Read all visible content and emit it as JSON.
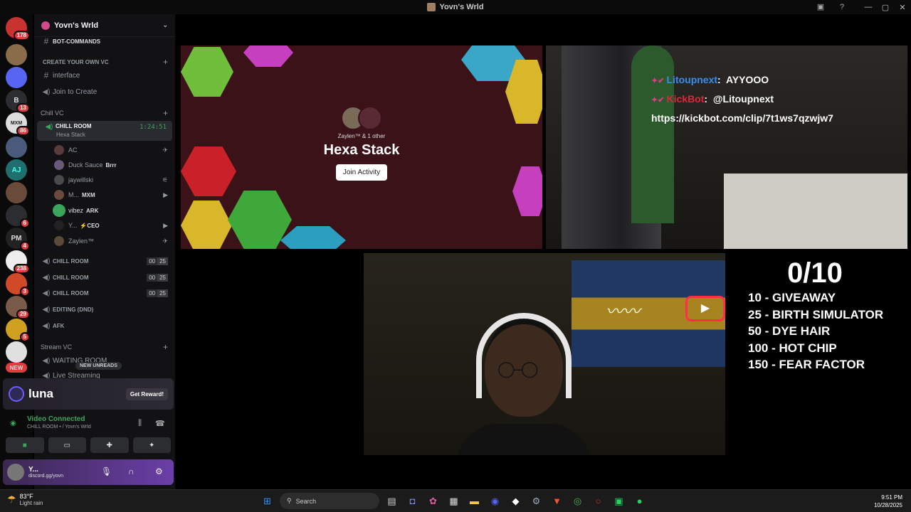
{
  "window": {
    "title": "Yovn's Wrld"
  },
  "rail": {
    "servers": [
      {
        "label": "",
        "badge": "178",
        "color": "#c8322f"
      },
      {
        "label": "",
        "badge": "",
        "color": "#8a6b4a"
      },
      {
        "label": "",
        "badge": "",
        "color": "#5865f2"
      },
      {
        "label": "B",
        "badge": "13",
        "color": "#444"
      },
      {
        "label": "MXM",
        "badge": "86",
        "color": "#ddd"
      },
      {
        "label": "",
        "badge": "",
        "color": "#4a5a7a"
      },
      {
        "label": "AJ",
        "badge": "",
        "color": "#3aa"
      },
      {
        "label": "",
        "badge": "",
        "color": "#6a4a3a"
      },
      {
        "label": "",
        "badge": "6",
        "color": "#555"
      },
      {
        "label": "PM",
        "badge": "4",
        "color": "#222"
      },
      {
        "label": "",
        "badge": "238",
        "color": "#eee"
      },
      {
        "label": "",
        "badge": "3",
        "color": "#d04a2a"
      },
      {
        "label": "",
        "badge": "29",
        "color": "#7a5a4a"
      },
      {
        "label": "",
        "badge": "5",
        "color": "#d0a020"
      },
      {
        "label": "",
        "badge": "",
        "color": "#e0e0e0"
      }
    ],
    "new_label": "NEW"
  },
  "sidebar": {
    "guild_name": "Yovn's Wrld",
    "bot_channel": "BOT-COMMANDS",
    "cat_create": "CREATE YOUR OWN VC",
    "ch_interface": "interface",
    "ch_join": "Join to Create",
    "cat_chill": "Chill VC",
    "active": {
      "name": "CHILL ROOM",
      "activity": "Hexa Stack",
      "timer": "1:24:51"
    },
    "members": [
      {
        "name": "AC",
        "tag": "",
        "icon": "✈"
      },
      {
        "name": "Duck Sauce",
        "tag": "Brrr",
        "icon": ""
      },
      {
        "name": "jaywillski",
        "tag": "",
        "icon": "⚟"
      },
      {
        "name": "M...",
        "tag": "MXM",
        "icon": "▶"
      },
      {
        "name": "vibez",
        "tag": "ARK",
        "icon": ""
      },
      {
        "name": "Y...",
        "tag": "⚡CEO",
        "icon": "▶"
      },
      {
        "name": "Zaylen™",
        "tag": "",
        "icon": "✈"
      }
    ],
    "rooms": [
      {
        "name": "CHILL ROOM",
        "c1": "00",
        "c2": "25"
      },
      {
        "name": "CHILL ROOM",
        "c1": "00",
        "c2": "25"
      },
      {
        "name": "CHILL ROOM",
        "c1": "00",
        "c2": "25"
      }
    ],
    "ch_editing": "EDITING (DND)",
    "ch_afk": "AFK",
    "cat_stream": "Stream VC",
    "ch_waiting": "WAITING ROOM",
    "ch_live": "Live Streaming",
    "new_unreads": "NEW UNREADS"
  },
  "luna": {
    "name": "luna",
    "reward": "Get Reward!"
  },
  "voice": {
    "status": "Video Connected",
    "location": "CHILL ROOM • / Yovn's Wrld"
  },
  "user_panel": {
    "name": "Y...",
    "status": "discord.gg/yovn"
  },
  "activity": {
    "by": "Zaylen™ & 1 other",
    "title": "Hexa Stack",
    "join": "Join Activity"
  },
  "overlay": {
    "line1_name": "Litoupnext",
    "line1_msg": "AYYOOO",
    "line2_name": "KickBot",
    "line2_msg": "@Litoupnext",
    "line3": "https://kickbot.com/clip/7t1ws7qzwjw7"
  },
  "goals": {
    "score": "0/10",
    "items": [
      "10 - GIVEAWAY",
      "25 - BIRTH SIMULATOR",
      "50 - DYE HAIR",
      "100 - HOT CHIP",
      "150 - FEAR FACTOR"
    ]
  },
  "taskbar": {
    "temp": "83°F",
    "condition": "Light rain",
    "search": "Search",
    "time": "9:51 PM",
    "date": "10/28/2025"
  },
  "colors": {
    "green": "#3ba55d",
    "accent": "#5865f2",
    "red": "#e03b3e"
  }
}
